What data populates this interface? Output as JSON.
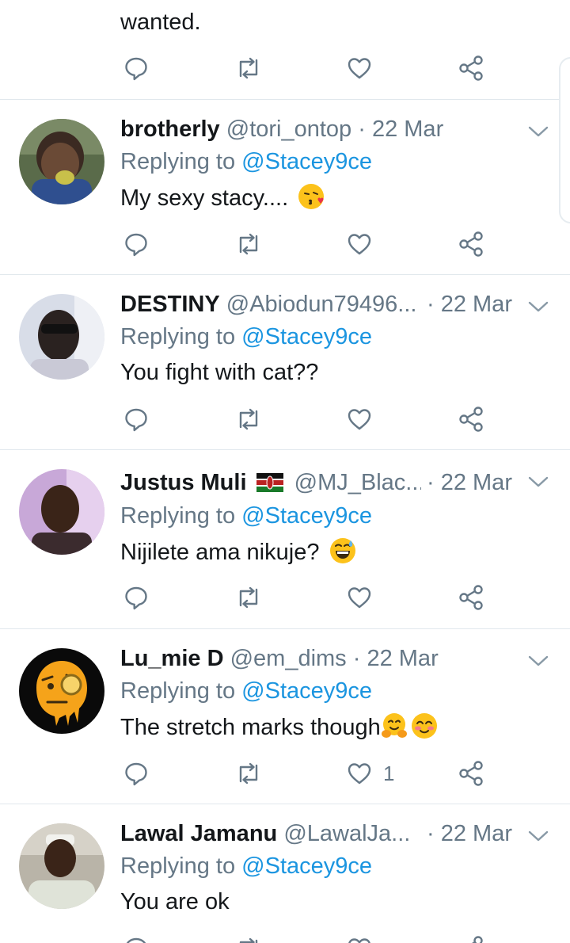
{
  "top": {
    "text": "wanted."
  },
  "tweets": [
    {
      "name": "brotherly",
      "handle": "@tori_ontop",
      "date": "· 22 Mar",
      "replying_prefix": "Replying to ",
      "mention": "@Stacey9ce",
      "body": "My sexy stacy....",
      "likes": ""
    },
    {
      "name": "DESTINY",
      "handle": "@Abiodun79496...",
      "date": "· 22 Mar",
      "replying_prefix": "Replying to ",
      "mention": "@Stacey9ce",
      "body": "You fight with cat??",
      "likes": ""
    },
    {
      "name": "Justus Muli",
      "handle": "@MJ_Blac...",
      "date": "· 22 Mar",
      "replying_prefix": "Replying to ",
      "mention": "@Stacey9ce",
      "body": "Nijilete ama nikuje?",
      "likes": ""
    },
    {
      "name": "Lu_mie D",
      "handle": "@em_dims",
      "date": "· 22 Mar",
      "replying_prefix": "Replying to ",
      "mention": "@Stacey9ce",
      "body": "The stretch marks though",
      "likes": "1"
    },
    {
      "name": "Lawal Jamanu",
      "handle": "@LawalJa...",
      "date": "· 22 Mar",
      "replying_prefix": "Replying to ",
      "mention": "@Stacey9ce",
      "body": "You are ok",
      "likes": ""
    }
  ],
  "icons": {
    "reply": "reply-icon",
    "retweet": "retweet-icon",
    "like": "heart-icon",
    "share": "share-icon",
    "caret": "chevron-down-icon",
    "flag": "kenya-flag-icon"
  },
  "colors": {
    "text": "#14171a",
    "secondary": "#657786",
    "link": "#1b95e0",
    "divider": "#e1e8ed"
  }
}
